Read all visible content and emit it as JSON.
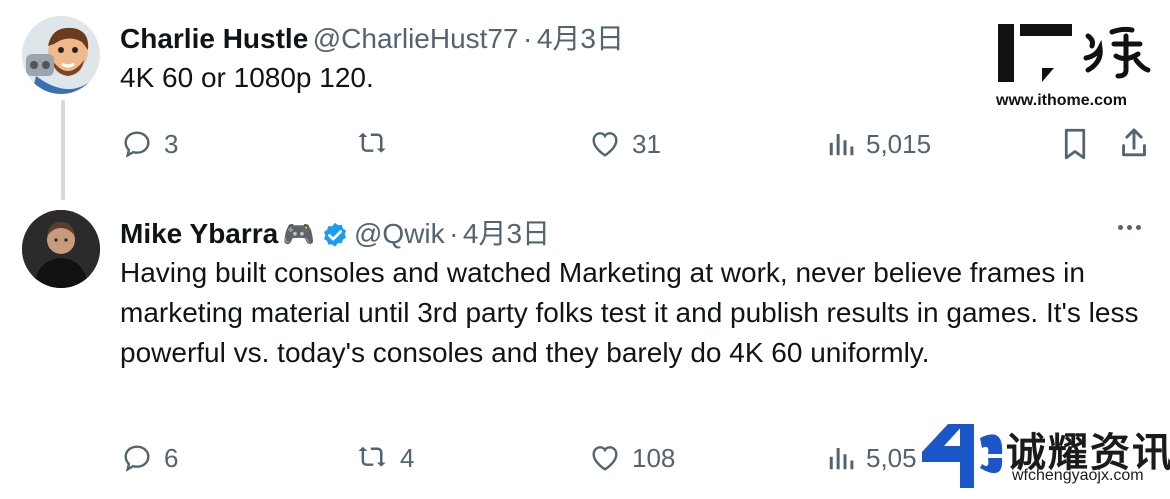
{
  "tweets": [
    {
      "author": "Charlie Hustle",
      "handle": "@CharlieHust77",
      "separator": "·",
      "date": "4月3日",
      "text": "4K 60 or 1080p 120.",
      "replies": "3",
      "retweets": "",
      "likes": "31",
      "views": "5,015",
      "avatar_icon": "cartoon-avatar"
    },
    {
      "author": "Mike Ybarra",
      "emoji": "🎮",
      "handle": "@Qwik",
      "separator": "·",
      "date": "4月3日",
      "text": "Having built consoles and watched Marketing at work, never believe frames in marketing material until 3rd party folks test it and publish results in games. It's less powerful vs. today's consoles and they barely do 4K 60 uniformly.",
      "replies": "6",
      "retweets": "4",
      "likes": "108",
      "views": "5,05",
      "avatar_icon": "photo-avatar"
    }
  ],
  "watermarks": {
    "ithome_logo": "IT之家",
    "ithome_url": "www.ithome.com",
    "wfc_name": "诚耀资讯",
    "wfc_url": "wfchengyaojx.com"
  },
  "colors": {
    "text": "#0f1419",
    "muted": "#536471",
    "verified": "#1d9bf0",
    "line": "#cfd9de",
    "wm_blue": "#1a56c8"
  }
}
